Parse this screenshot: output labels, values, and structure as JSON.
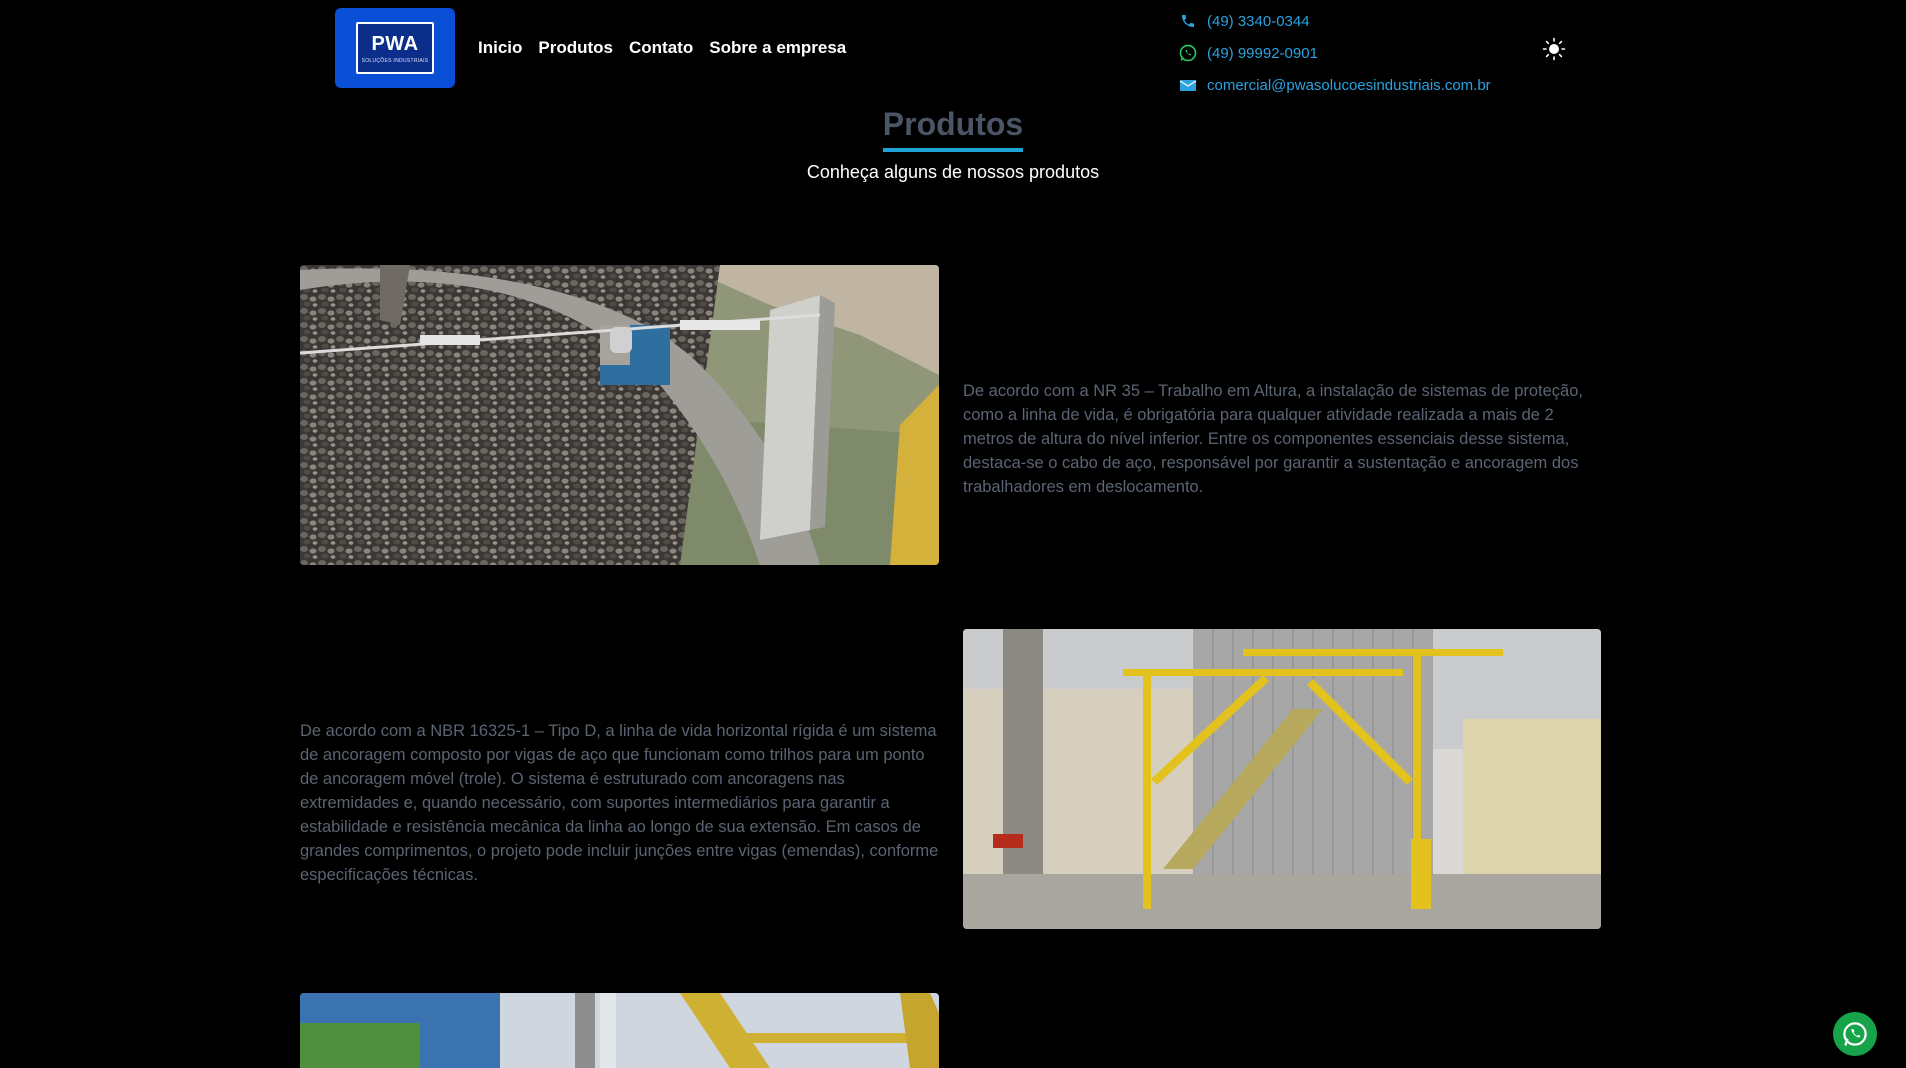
{
  "header": {
    "logo": {
      "text": "PWA",
      "subtext": "SOLUÇÕES INDUSTRIAIS"
    },
    "nav": [
      {
        "label": "Inicio"
      },
      {
        "label": "Produtos"
      },
      {
        "label": "Contato"
      },
      {
        "label": "Sobre a empresa"
      }
    ],
    "contacts": {
      "phone": "(49) 3340-0344",
      "whatsapp": "(49) 99992-0901",
      "email": "comercial@pwasolucoesindustriais.com.br"
    },
    "theme_toggle_icon": "sun-icon"
  },
  "section": {
    "title": "Produtos",
    "subtitle": "Conheça alguns de nossos produtos"
  },
  "products": [
    {
      "description": "De acordo com a NR 35 – Trabalho em Altura, a instalação de sistemas de proteção, como a linha de vida, é obrigatória para qualquer atividade realizada a mais de 2 metros de altura do nível inferior. Entre os componentes essenciais desse sistema, destaca-se o cabo de aço, responsável por garantir a sustentação e ancoragem dos trabalhadores em deslocamento."
    },
    {
      "description": "De acordo com a NBR 16325-1 – Tipo D, a linha de vida horizontal rígida é um sistema de ancoragem composto por vigas de aço que funcionam como trilhos para um ponto de ancoragem móvel (trole). O sistema é estruturado com ancoragens nas extremidades e, quando necessário, com suportes intermediários para garantir a estabilidade e resistência mecânica da linha ao longo de sua extensão. Em casos de grandes comprimentos, o projeto pode incluir junções entre vigas (emendas), conforme especificações técnicas."
    },
    {
      "description": ""
    }
  ],
  "colors": {
    "background": "#000000",
    "accent": "#1ea4d6",
    "link": "#2aa3e0",
    "logo_bg": "#0a4fd6",
    "muted_text": "#5b6472",
    "whatsapp": "#16a34a"
  },
  "floating": {
    "icon": "whatsapp-icon"
  }
}
